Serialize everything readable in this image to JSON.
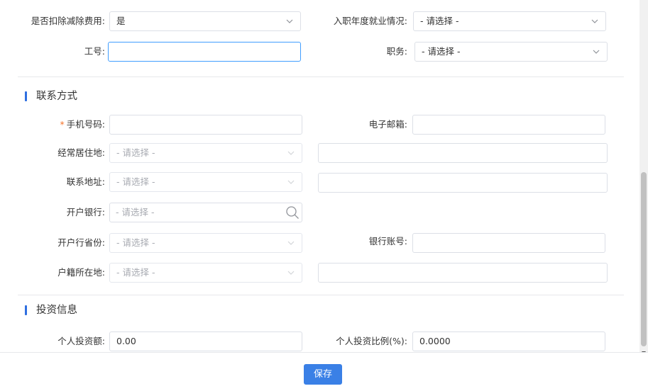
{
  "row_deduct": {
    "label": "是否扣除减除费用:",
    "value": "是"
  },
  "row_employment": {
    "label": "入职年度就业情况:",
    "placeholder": "- 请选择 -"
  },
  "row_worknum": {
    "label": "工号:",
    "value": ""
  },
  "row_position": {
    "label": "职务:",
    "placeholder": "- 请选择 -"
  },
  "section_contact": {
    "title": "联系方式"
  },
  "phone": {
    "required_mark": "*",
    "label": "手机号码:",
    "value": ""
  },
  "email": {
    "label": "电子邮箱:",
    "value": ""
  },
  "residence": {
    "label": "经常居住地:",
    "placeholder": "- 请选择 -"
  },
  "address": {
    "label": "联系地址:",
    "placeholder": "- 请选择 -"
  },
  "bank": {
    "label": "开户银行:",
    "placeholder": "- 请选择 -"
  },
  "bank_province": {
    "label": "开户行省份:",
    "placeholder": "- 请选择 -"
  },
  "bank_account": {
    "label": "银行账号:",
    "value": ""
  },
  "hukou": {
    "label": "户籍所在地:",
    "placeholder": "- 请选择 -"
  },
  "section_invest": {
    "title": "投资信息"
  },
  "invest_amount": {
    "label": "个人投资额:",
    "value": "0.00"
  },
  "invest_ratio": {
    "label": "个人投资比例(%):",
    "value": "0.0000"
  },
  "footer": {
    "save_label": "保存"
  },
  "icons": {
    "select_arrow": "chevron-down-icon",
    "search": "search-icon"
  },
  "colors": {
    "accent": "#3a80e6",
    "required": "#f5732a",
    "focus_border": "#409eff"
  }
}
